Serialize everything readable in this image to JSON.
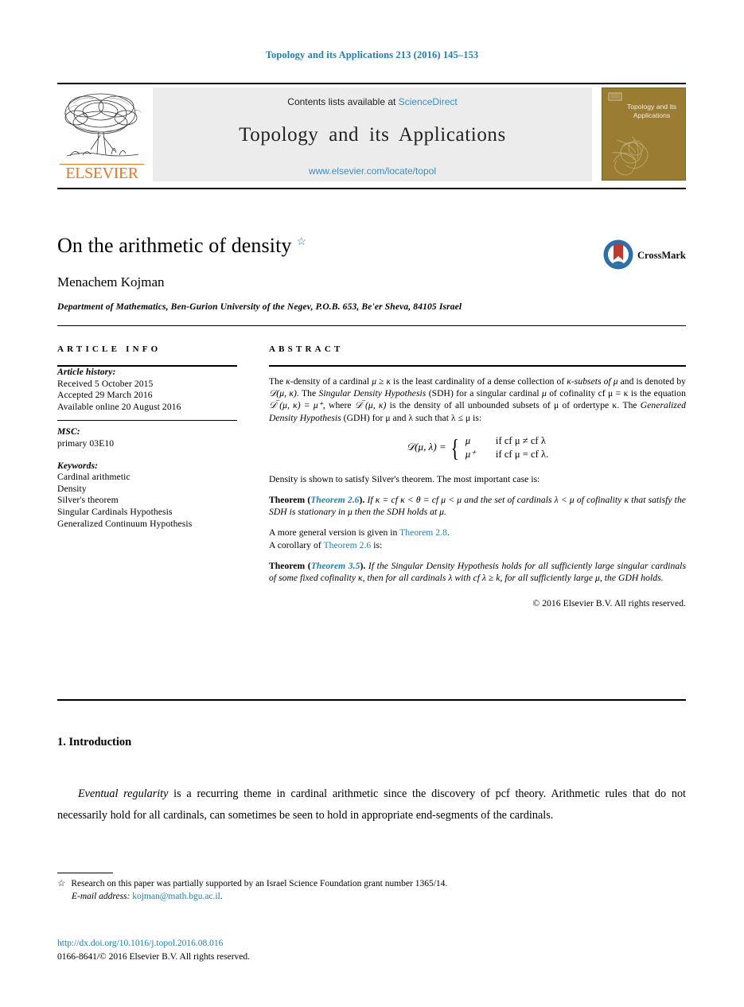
{
  "running_head": "Topology and its Applications 213 (2016) 145–153",
  "masthead": {
    "contents_prefix": "Contents lists available at ",
    "sciencedirect": "ScienceDirect",
    "journal_title": "Topology and its Applications",
    "journal_url": "www.elsevier.com/locate/topol",
    "publisher_wordmark": "ELSEVIER",
    "cover_title": "Topology and its Applications",
    "link_color": "#3a8fc4"
  },
  "article": {
    "title": "On the arithmetic of density",
    "title_footnote_marker": "☆",
    "author": "Menachem Kojman",
    "affiliation": "Department of Mathematics, Ben-Gurion University of the Negev, P.O.B. 653, Be'er Sheva, 84105 Israel",
    "crossmark_label": "CrossMark"
  },
  "info": {
    "heading": "ARTICLE INFO",
    "history_label": "Article history:",
    "history": [
      "Received 5 October 2015",
      "Accepted 29 March 2016",
      "Available online 20 August 2016"
    ],
    "msc_label": "MSC:",
    "msc": "primary 03E10",
    "keywords_label": "Keywords:",
    "keywords": [
      "Cardinal arithmetic",
      "Density",
      "Silver's theorem",
      "Singular Cardinals Hypothesis",
      "Generalized Continuum Hypothesis"
    ]
  },
  "abstract": {
    "heading": "ABSTRACT",
    "p1_a": "The ",
    "p1_kappa": "κ",
    "p1_b": "-density of a cardinal ",
    "p1_mu": "μ ≥ κ",
    "p1_c": " is the least cardinality of a dense collection of ",
    "p1_d": "κ-subsets of ",
    "p1_e": "μ",
    "p1_f": " and is denoted by ",
    "p1_dmk": "𝒟(μ, κ)",
    "p1_g": ". The ",
    "p1_sdh_it": "Singular Density Hypothesis",
    "p1_h": " (SDH) for a singular cardinal ",
    "p1_i": "μ",
    "p1_j": " of cofinality cf μ = κ is the equation ",
    "p1_eq": "𝒟‾(μ, κ) = μ⁺",
    "p1_k": ", where ",
    "p1_l": "𝒟‾(μ, κ)",
    "p1_m": " is the density of all unbounded subsets of μ of ordertype κ. The ",
    "p1_gdh_it": "Generalized Density Hypothesis",
    "p1_n": " (GDH) for μ and λ such that λ ≤ μ is:",
    "equation": {
      "lhs": "𝒟(μ, λ) =",
      "case1_value": "μ",
      "case1_cond": "if cf μ ≠ cf λ",
      "case2_value": "μ⁺",
      "case2_cond": "if cf μ = cf λ."
    },
    "p2": "Density is shown to satisfy Silver's theorem. The most important case is:",
    "thm1_label": "Theorem",
    "thm1_ref": "Theorem 2.6",
    "thm1_body": "If κ = cf κ < θ = cf μ < μ and the set of cardinals λ < μ of cofinality κ that satisfy the SDH is stationary in μ then the SDH holds at μ.",
    "p3_a": "A more general version is given in ",
    "p3_ref": "Theorem 2.8",
    "p3_b": ".",
    "p4_a": "A corollary of ",
    "p4_ref": "Theorem 2.6",
    "p4_b": " is:",
    "thm2_label": "Theorem",
    "thm2_ref": "Theorem 3.5",
    "thm2_body": "If the Singular Density Hypothesis holds for all sufficiently large singular cardinals of some fixed cofinality κ, then for all cardinals λ with cf λ ≥ k, for all sufficiently large μ, the GDH holds.",
    "copyright": "© 2016 Elsevier B.V. All rights reserved."
  },
  "body": {
    "section_number_title": "1. Introduction",
    "para_lead_italic": "Eventual regularity",
    "para_rest": " is a recurring theme in cardinal arithmetic since the discovery of pcf theory. Arithmetic rules that do not necessarily hold for all cardinals, can sometimes be seen to hold in appropriate end-segments of the cardinals."
  },
  "footnotes": {
    "marker": "☆",
    "grant": "Research on this paper was partially supported by an Israel Science Foundation grant number 1365/14.",
    "email_label": "E-mail address:",
    "email": "kojman@math.bgu.ac.il",
    "email_period": ".",
    "doi": "http://dx.doi.org/10.1016/j.topol.2016.08.016",
    "imprint": "0166-8641/© 2016 Elsevier B.V. All rights reserved."
  }
}
